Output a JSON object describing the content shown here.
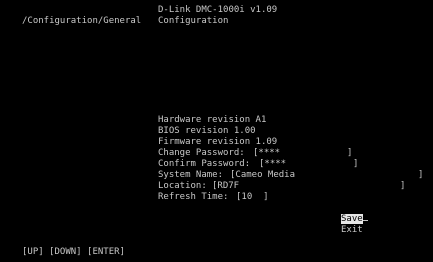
{
  "header": {
    "device_title": "D-Link DMC-1000i v1.09",
    "path": "/Configuration/General",
    "section": "Configuration"
  },
  "info": {
    "hardware": "Hardware revision A1",
    "bios": "BIOS revision 1.00",
    "firmware": "Firmware revision 1.09"
  },
  "fields": {
    "change_password_label": "Change Password:",
    "change_password_value": "[****",
    "confirm_password_label": "Confirm Password:",
    "confirm_password_value": "[****",
    "system_name_label": "System Name:",
    "system_name_value": "[Cameo Media",
    "location_label": "Location:",
    "location_value": "[RD7F",
    "refresh_time_label": "Refresh Time:",
    "refresh_time_value": "[10  ]",
    "field_end_bracket": "]"
  },
  "menu": {
    "save": "Save",
    "exit": "Exit"
  },
  "footer": {
    "keys": "[UP] [DOWN] [ENTER]"
  },
  "colors": {
    "background": "#000000",
    "text": "#c8c8c8",
    "selected_bg": "#e6e6e6",
    "selected_text": "#000000"
  }
}
